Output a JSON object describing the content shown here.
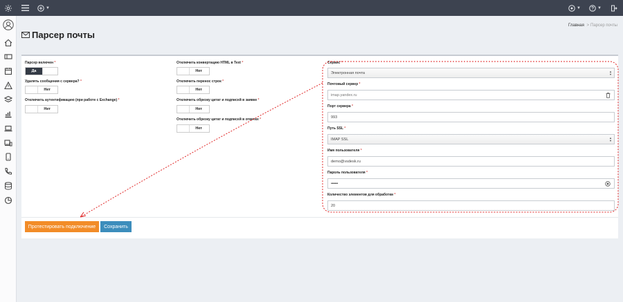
{
  "header": {
    "title": "Парсер почты",
    "breadcrumb": {
      "home": "Главная",
      "separator": ">",
      "current": "Парсер почты"
    }
  },
  "icons": {
    "topbar": [
      "gear-icon",
      "menu-icon",
      "add-circle-icon",
      "settings-circle-icon",
      "help-icon",
      "logout-icon"
    ],
    "sidebar": [
      "avatar",
      "home-icon",
      "ticket-icon",
      "calendar-icon",
      "warning-icon",
      "layers-icon",
      "chart-icon",
      "laptop-icon",
      "devices-icon",
      "phone-icon",
      "call-icon",
      "database-icon",
      "pie-chart-icon"
    ]
  },
  "left_column": {
    "parser_enabled": {
      "label": "Парсер включен",
      "required": "*",
      "value": "Да"
    },
    "delete_messages": {
      "label": "Удалять сообщения с сервера?",
      "required": "*",
      "value": "Нет"
    },
    "disable_auth": {
      "label": "Отключить аутентификацию (при работе с Exchange)",
      "required": "*",
      "value": "Нет"
    }
  },
  "middle_column": {
    "disable_html_conversion": {
      "label": "Отключить конвертацию HTML в Text",
      "required": "*",
      "value": "Нет"
    },
    "disable_line_breaks": {
      "label": "Отключить перенос строк",
      "required": "*",
      "value": "Нет"
    },
    "disable_quote_trim_request": {
      "label": "Отключить обрезку цитат и подписей в заявке",
      "required": "*",
      "value": "Нет"
    },
    "disable_quote_trim_replies": {
      "label": "Отключить обрезку цитат и подписей в ответах",
      "required": "*",
      "value": "Нет"
    }
  },
  "right_column": {
    "service": {
      "label": "Сервис",
      "required": "*",
      "value": "Электронная почта"
    },
    "mail_server": {
      "label": "Почтовый сервер",
      "required": "*",
      "value": "imap.yandex.ru"
    },
    "server_port": {
      "label": "Порт сервера",
      "required": "*",
      "value": "993"
    },
    "ssl_path": {
      "label": "Путь SSL",
      "required": "*",
      "value": "IMAP SSL"
    },
    "username": {
      "label": "Имя пользователя",
      "required": "*",
      "value": "demo@vsdesk.ru"
    },
    "password": {
      "label": "Пароль пользователя",
      "required": "*",
      "value": "•••••••"
    },
    "items_count": {
      "label": "Количество элементов для обработки",
      "required": "*",
      "value": "20"
    }
  },
  "actions": {
    "test_label": "Протестировать подключение",
    "save_label": "Сохранить"
  },
  "colors": {
    "topbar": "#3d4350",
    "toggle_on": "#333a45",
    "test_button": "#f28c28",
    "save_button": "#3c8dbc",
    "annotation": "#e02424"
  }
}
